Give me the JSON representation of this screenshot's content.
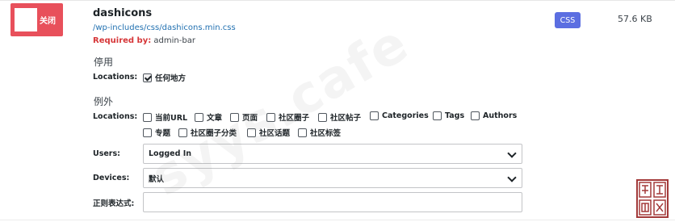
{
  "asset": {
    "toggle_label": "关闭",
    "name": "dashicons",
    "path": "/wp-includes/css/dashicons.min.css",
    "required_by_label": "Required by:",
    "required_by_value": "admin-bar",
    "type_badge": "CSS",
    "size": "57.6 KB"
  },
  "unload": {
    "heading": "停用",
    "locations_label": "Locations:",
    "options": [
      {
        "label": "任何地方",
        "checked": true
      }
    ]
  },
  "exceptions": {
    "heading": "例外",
    "locations_label": "Locations:",
    "options": [
      {
        "label": "当前URL",
        "checked": false
      },
      {
        "label": "文章",
        "checked": false
      },
      {
        "label": "页面",
        "checked": false
      },
      {
        "label": "社区圈子",
        "checked": false
      },
      {
        "label": "社区帖子",
        "checked": false
      },
      {
        "label": "Categories",
        "checked": false
      },
      {
        "label": "Tags",
        "checked": false
      },
      {
        "label": "Authors",
        "checked": false
      },
      {
        "label": "专题",
        "checked": false
      },
      {
        "label": "社区圈子分类",
        "checked": false
      },
      {
        "label": "社区话题",
        "checked": false
      },
      {
        "label": "社区标签",
        "checked": false
      }
    ],
    "users_label": "Users:",
    "users_value": "Logged In",
    "devices_label": "Devices:",
    "devices_value": "默认",
    "regex_label": "正则表达式:",
    "regex_value": ""
  },
  "watermark": "syys.cafe",
  "colors": {
    "toggle_off": "#e8505b",
    "badge": "#5b6ee1",
    "link": "#2271b1",
    "required": "#d63638"
  }
}
